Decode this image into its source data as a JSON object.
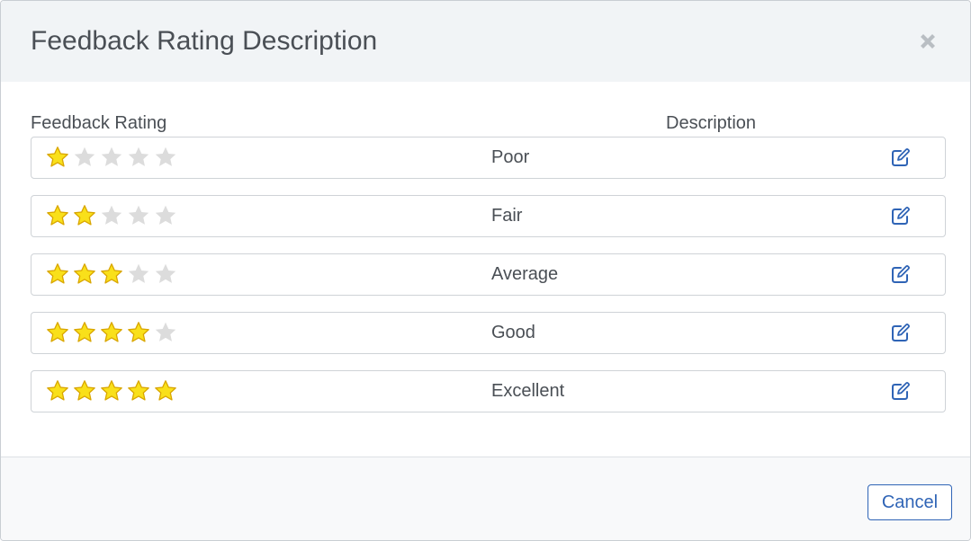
{
  "dialog": {
    "title": "Feedback Rating Description",
    "close_icon": "close-icon"
  },
  "columns": {
    "rating": "Feedback Rating",
    "description": "Description"
  },
  "ratings": [
    {
      "stars": 1,
      "max_stars": 5,
      "label": "Poor"
    },
    {
      "stars": 2,
      "max_stars": 5,
      "label": "Fair"
    },
    {
      "stars": 3,
      "max_stars": 5,
      "label": "Average"
    },
    {
      "stars": 4,
      "max_stars": 5,
      "label": "Good"
    },
    {
      "stars": 5,
      "max_stars": 5,
      "label": "Excellent"
    }
  ],
  "row_action_icon": "edit-icon",
  "footer": {
    "cancel_label": "Cancel"
  },
  "colors": {
    "star_filled": "#f9e01a",
    "star_filled_stroke": "#d9a600",
    "star_empty": "#dcdcdc",
    "accent": "#2f64b6",
    "header_bg": "#f1f4f6",
    "text": "#4a4f55"
  }
}
